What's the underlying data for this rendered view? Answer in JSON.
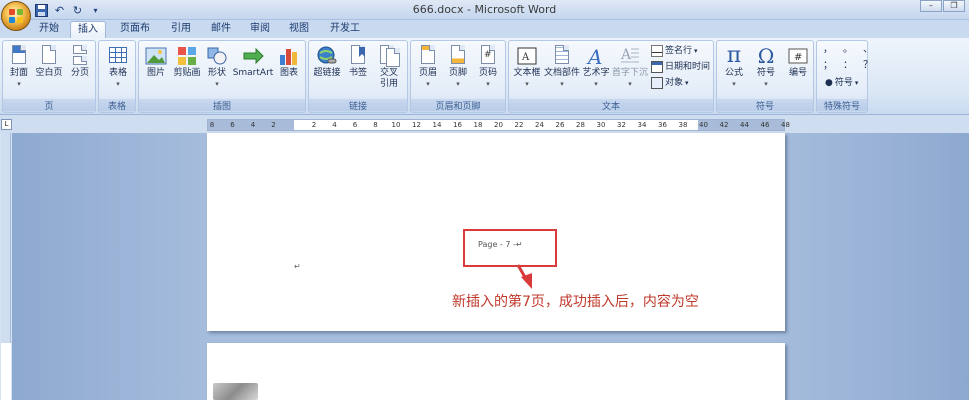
{
  "window": {
    "title": "666.docx - Microsoft Word",
    "controls": [
      "–",
      "❐",
      "✕"
    ]
  },
  "quick_access": {
    "items": [
      "save-icon",
      "undo-icon",
      "redo-icon",
      "customize-icon"
    ]
  },
  "tabs": [
    "开始",
    "插入",
    "页面布局",
    "引用",
    "邮件",
    "审阅",
    "视图",
    "开发工具"
  ],
  "ribbon": {
    "page_group": {
      "label": "页",
      "buttons": [
        "封面",
        "空白页",
        "分页"
      ]
    },
    "table_group": {
      "label": "表格",
      "buttons": [
        "表格"
      ]
    },
    "illustrations_group": {
      "label": "插图",
      "buttons": [
        "图片",
        "剪贴画",
        "形状",
        "SmartArt",
        "图表"
      ]
    },
    "links_group": {
      "label": "链接",
      "buttons": [
        "超链接",
        "书签",
        "交叉",
        "引用"
      ]
    },
    "header_footer_group": {
      "label": "页眉和页脚",
      "buttons": [
        "页眉",
        "页脚",
        "页码"
      ]
    },
    "text_group": {
      "label": "文本",
      "buttons": [
        "文本框",
        "文档部件",
        "艺术字",
        "首字下沉"
      ],
      "small": [
        "签名行",
        "日期和时间",
        "对象"
      ]
    },
    "symbols_group": {
      "label": "符号",
      "buttons": [
        "公式",
        "符号",
        "编号"
      ]
    },
    "special_group": {
      "label": "特殊符号",
      "button": "符号",
      "chars": [
        "，",
        "。",
        "、",
        "；",
        "：",
        "？"
      ]
    }
  },
  "ruler": {
    "numbers": [
      "8",
      "6",
      "4",
      "2",
      "2",
      "4",
      "6",
      "8",
      "10",
      "12",
      "14",
      "16",
      "18",
      "20",
      "22",
      "24",
      "26",
      "28",
      "30",
      "32",
      "34",
      "36",
      "38",
      "40",
      "42",
      "44",
      "46",
      "48"
    ]
  },
  "document": {
    "footer_text": "Page - 7 -↵",
    "paragraph_mark": "↵",
    "annotation": "新插入的第7页，成功插入后，内容为空"
  }
}
